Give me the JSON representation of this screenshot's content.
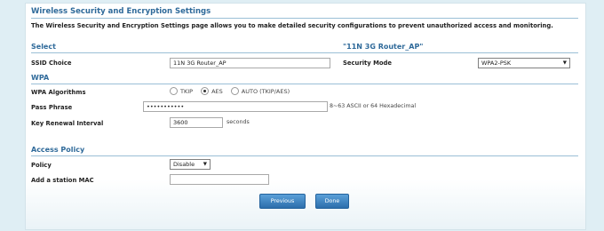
{
  "header": {
    "title": "Wireless Security and Encryption Settings",
    "description": "The Wireless Security and Encryption Settings page allows you to make detailed security configurations to prevent unauthorized access and monitoring."
  },
  "select_section": {
    "title": "Select",
    "network_name": "\"11N 3G Router_AP\"",
    "ssid_label": "SSID Choice",
    "ssid_value": "11N 3G Router_AP",
    "security_mode_label": "Security Mode",
    "security_mode_value": "WPA2-PSK"
  },
  "wpa_section": {
    "title": "WPA",
    "algorithms_label": "WPA Algorithms",
    "algorithms": [
      {
        "label": "TKIP",
        "selected": false
      },
      {
        "label": "AES",
        "selected": true
      },
      {
        "label": "AUTO (TKIP/AES)",
        "selected": false
      }
    ],
    "pass_phrase_label": "Pass Phrase",
    "pass_phrase_value": "•••••••••••",
    "pass_phrase_hint": "8~63 ASCII or 64 Hexadecimal",
    "key_renewal_label": "Key Renewal Interval",
    "key_renewal_value": "3600",
    "key_renewal_unit": "seconds"
  },
  "access_policy_section": {
    "title": "Access Policy",
    "policy_label": "Policy",
    "policy_value": "Disable",
    "add_mac_label": "Add a station MAC",
    "add_mac_value": ""
  },
  "buttons": {
    "previous": "Previous",
    "done": "Done"
  }
}
